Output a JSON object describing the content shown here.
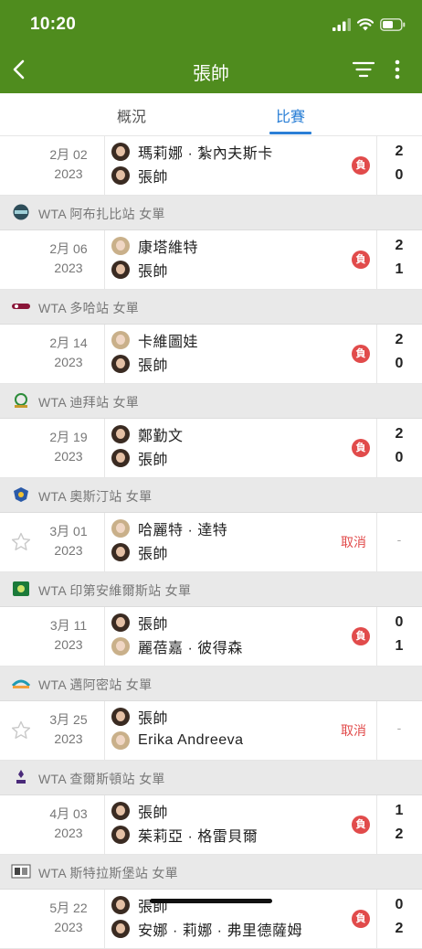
{
  "status": {
    "time": "10:20"
  },
  "nav": {
    "title": "張帥"
  },
  "tabs": [
    {
      "label": "概況"
    },
    {
      "label": "比賽"
    }
  ],
  "colors": {
    "brand": "#4f8c1e",
    "accent": "#2a7fd6",
    "loss": "#e14b4b"
  },
  "feed": [
    {
      "kind": "match",
      "star": false,
      "date": "2月 02",
      "year": "2023",
      "p1": "瑪莉娜 · 紮內夫斯卡",
      "p2": "張帥",
      "badge": "負",
      "s1": "2",
      "s2": "0"
    },
    {
      "kind": "header",
      "logo": "abu-dhabi-logo",
      "text": "WTA 阿布扎比站 女單"
    },
    {
      "kind": "match",
      "star": false,
      "date": "2月 06",
      "year": "2023",
      "p1": "康塔維特",
      "p2": "張帥",
      "badge": "負",
      "s1": "2",
      "s2": "1"
    },
    {
      "kind": "header",
      "logo": "doha-logo",
      "text": "WTA 多哈站 女單"
    },
    {
      "kind": "match",
      "star": false,
      "date": "2月 14",
      "year": "2023",
      "p1": "卡維圖娃",
      "p2": "張帥",
      "badge": "負",
      "s1": "2",
      "s2": "0"
    },
    {
      "kind": "header",
      "logo": "dubai-logo",
      "text": "WTA 迪拜站 女單"
    },
    {
      "kind": "match",
      "star": false,
      "date": "2月 19",
      "year": "2023",
      "p1": "鄭勤文",
      "p2": "張帥",
      "badge": "負",
      "s1": "2",
      "s2": "0"
    },
    {
      "kind": "header",
      "logo": "austin-logo",
      "text": "WTA 奧斯汀站 女單"
    },
    {
      "kind": "match",
      "star": true,
      "date": "3月 01",
      "year": "2023",
      "p1": "哈麗特 · 達特",
      "p2": "張帥",
      "status": "取消",
      "dash": "-"
    },
    {
      "kind": "header",
      "logo": "indian-wells-logo",
      "text": "WTA 印第安維爾斯站 女單"
    },
    {
      "kind": "match",
      "star": false,
      "date": "3月 11",
      "year": "2023",
      "p1": "張帥",
      "p2": "麗蓓嘉 · 彼得森",
      "badge": "負",
      "s1": "0",
      "s2": "1"
    },
    {
      "kind": "header",
      "logo": "miami-logo",
      "text": "WTA 邁阿密站 女單"
    },
    {
      "kind": "match",
      "star": true,
      "date": "3月 25",
      "year": "2023",
      "p1": "張帥",
      "p2": "Erika Andreeva",
      "status": "取消",
      "dash": "-"
    },
    {
      "kind": "header",
      "logo": "charleston-logo",
      "text": "WTA 查爾斯頓站 女單"
    },
    {
      "kind": "match",
      "star": false,
      "date": "4月 03",
      "year": "2023",
      "p1": "張帥",
      "p2": "茱莉亞 · 格雷貝爾",
      "badge": "負",
      "s1": "1",
      "s2": "2"
    },
    {
      "kind": "header",
      "logo": "stuttgart-logo",
      "text": "WTA 斯特拉斯堡站 女單"
    },
    {
      "kind": "match",
      "star": false,
      "date": "5月 22",
      "year": "2023",
      "p1": "張帥",
      "p2": "安娜 · 莉娜 · 弗里德薩姆",
      "badge": "負",
      "s1": "0",
      "s2": "2"
    }
  ]
}
